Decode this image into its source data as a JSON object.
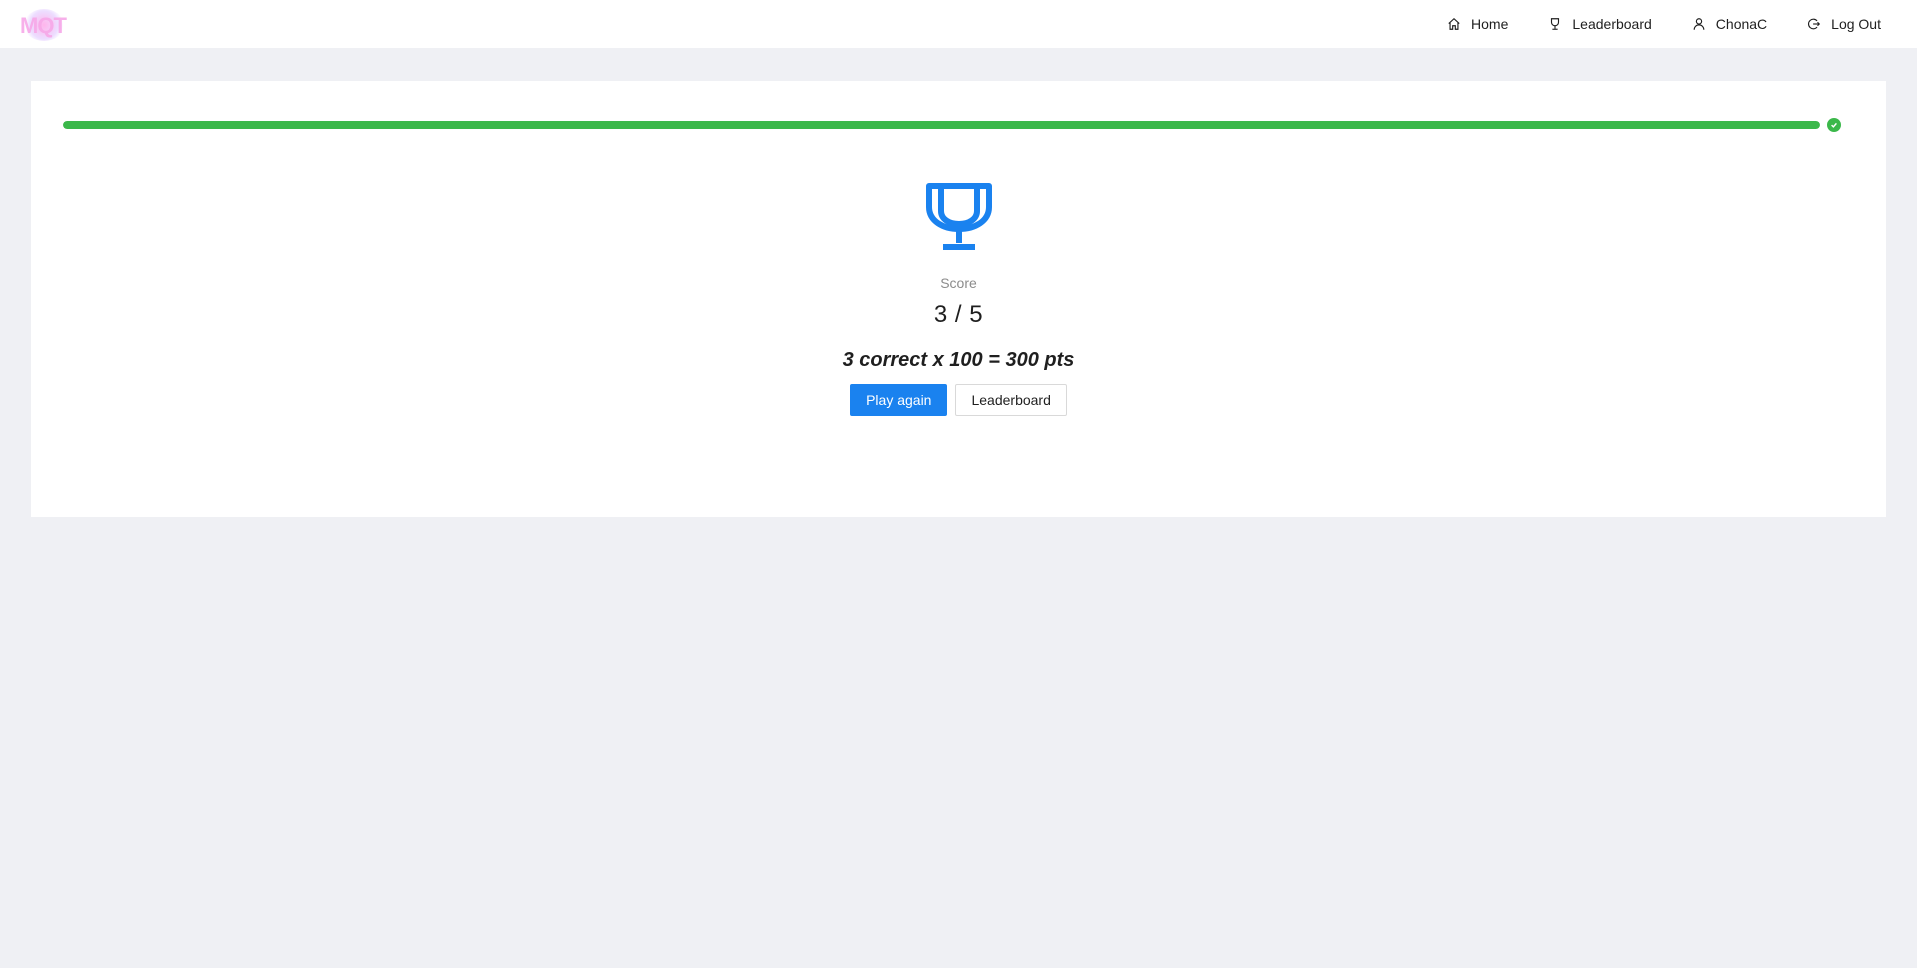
{
  "header": {
    "logo_text": "MQT",
    "nav": [
      {
        "label": "Home",
        "icon": "home-icon"
      },
      {
        "label": "Leaderboard",
        "icon": "trophy-icon"
      },
      {
        "label": "ChonaC",
        "icon": "user-icon"
      },
      {
        "label": "Log Out",
        "icon": "logout-icon"
      }
    ]
  },
  "progress": {
    "percent": 100,
    "status": "complete",
    "color": "#3bb84a"
  },
  "result": {
    "icon": "trophy-icon",
    "score_label": "Score",
    "score_value": "3 / 5",
    "points_text": "3 correct x 100 = 300 pts"
  },
  "actions": {
    "play_again_label": "Play again",
    "leaderboard_label": "Leaderboard"
  },
  "colors": {
    "accent": "#1a82ef",
    "success": "#3bb84a",
    "background": "#eff0f4"
  }
}
